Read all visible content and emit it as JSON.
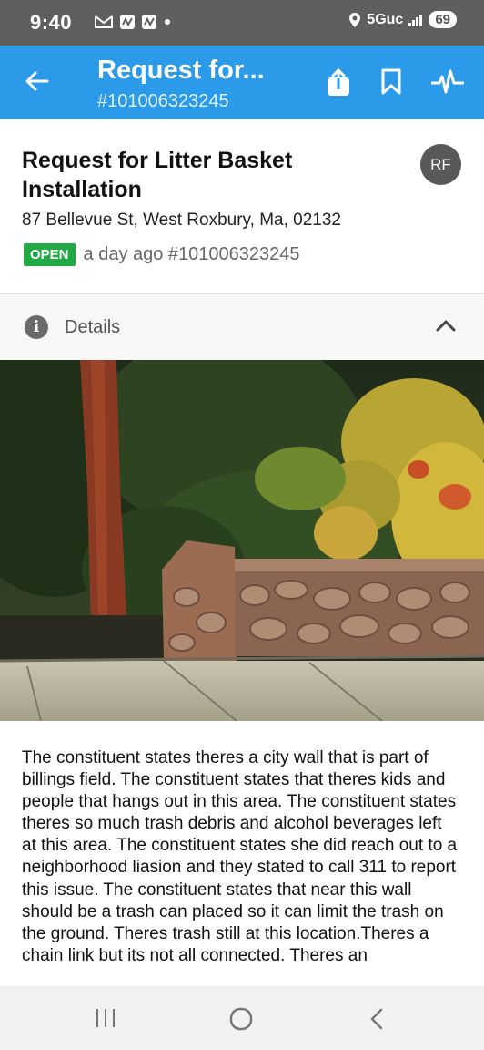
{
  "status_bar": {
    "time": "9:40",
    "network": "5Guc",
    "battery": "69"
  },
  "app_bar": {
    "title": "Request for...",
    "subtitle": "#101006323245"
  },
  "request": {
    "title": "Request for Litter Basket Installation",
    "avatar_initials": "RF",
    "address": "87 Bellevue St, West Roxbury, Ma, 02132",
    "status": "OPEN",
    "meta": "a day ago #101006323245"
  },
  "details": {
    "label": "Details"
  },
  "description": "The constituent states theres a city wall that is part of billings field. The constituent states that theres kids and people that hangs out in this area. The constituent states theres so much trash debris and alcohol beverages left at this area. The constituent states she did reach out to a neighborhood liasion and they stated to call 311 to report this issue. The constituent states that near this wall should be a trash can placed so it can limit the trash on the ground. Theres trash still at this location.Theres a chain link but its not all connected. Theres an",
  "colors": {
    "accent": "#2b9ae8",
    "open_badge": "#22a845",
    "status_bar": "#5f5f5f"
  },
  "icons": [
    "back-arrow-icon",
    "share-icon",
    "bookmark-icon",
    "activity-icon",
    "info-icon",
    "chevron-up-icon",
    "location-icon",
    "signal-icon",
    "recents-icon",
    "home-icon",
    "back-nav-icon"
  ]
}
